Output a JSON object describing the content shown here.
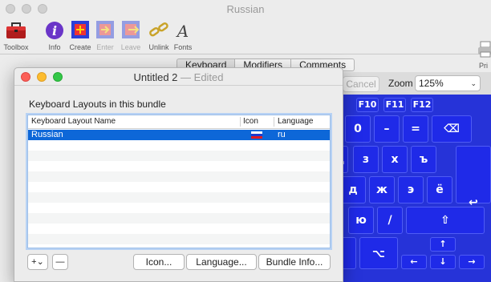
{
  "back_window": {
    "title": "Russian",
    "toolbar": [
      {
        "label": "Toolbox",
        "icon": "toolbox-icon",
        "enabled": true
      },
      {
        "label": "Info",
        "icon": "info-icon",
        "enabled": true
      },
      {
        "label": "Create",
        "icon": "create-icon",
        "enabled": true
      },
      {
        "label": "Enter",
        "icon": "enter-icon",
        "enabled": false
      },
      {
        "label": "Leave",
        "icon": "leave-icon",
        "enabled": false
      },
      {
        "label": "Unlink",
        "icon": "unlink-icon",
        "enabled": true
      },
      {
        "label": "Fonts",
        "icon": "fonts-icon",
        "enabled": true
      }
    ],
    "print_label": "Pri",
    "tabs": [
      "Keyboard",
      "Modifiers",
      "Comments"
    ],
    "cancel_label": "Cancel",
    "zoom_label": "Zoom",
    "zoom_value": "125%",
    "keyboard": {
      "fn_keys": [
        "F10",
        "F11",
        "F12"
      ],
      "keys": [
        "0",
        "–",
        "=",
        "⌫",
        "ц",
        "з",
        "х",
        "ъ",
        "д",
        "ж",
        "э",
        "ё",
        "↩",
        "ю",
        "/",
        "⇧",
        "⌥",
        "←",
        "↑",
        "↓",
        "→"
      ]
    },
    "colors": {
      "keyboard_bg": "#2633d8",
      "key_bg": "#1f2ae8"
    }
  },
  "front_window": {
    "title": "Untitled 2",
    "title_suffix": "— Edited",
    "section_title": "Keyboard Layouts in this bundle",
    "columns": [
      "Keyboard Layout Name",
      "Icon",
      "Language"
    ],
    "rows": [
      {
        "name": "Russian",
        "icon": "russian-flag-icon",
        "language": "ru",
        "selected": true
      }
    ],
    "buttons": {
      "add": "+⌄",
      "remove": "—",
      "icon": "Icon...",
      "language": "Language...",
      "bundle_info": "Bundle Info..."
    },
    "colors": {
      "selection": "#0d67d8"
    }
  }
}
